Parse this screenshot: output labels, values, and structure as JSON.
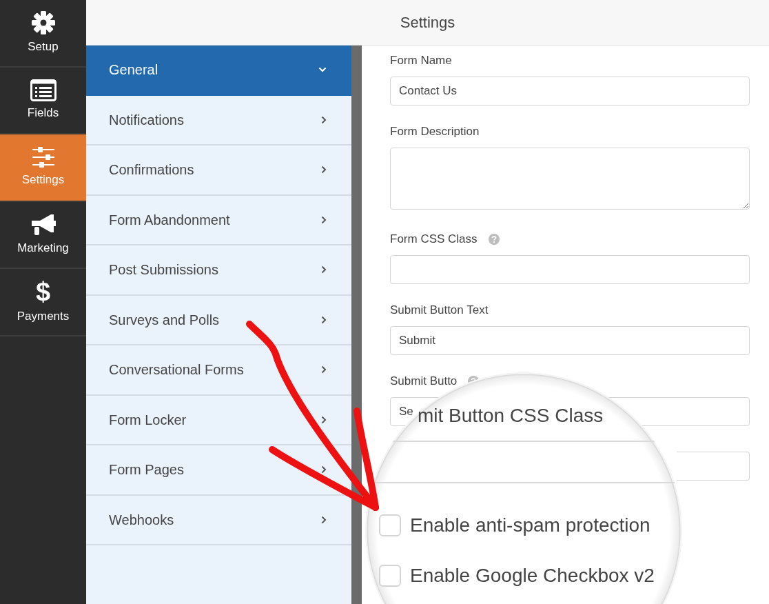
{
  "sidebar": {
    "items": [
      {
        "label": "Setup",
        "kind": "gear",
        "selected": false
      },
      {
        "label": "Fields",
        "kind": "list",
        "selected": false
      },
      {
        "label": "Settings",
        "kind": "sliders",
        "selected": true
      },
      {
        "label": "Marketing",
        "kind": "megaphone",
        "selected": false
      },
      {
        "label": "Payments",
        "kind": "glyph",
        "glyph": "$",
        "selected": false
      }
    ]
  },
  "header": {
    "title": "Settings"
  },
  "sections": [
    {
      "label": "General",
      "selected": true
    },
    {
      "label": "Notifications",
      "selected": false
    },
    {
      "label": "Confirmations",
      "selected": false
    },
    {
      "label": "Form Abandonment",
      "selected": false
    },
    {
      "label": "Post Submissions",
      "selected": false
    },
    {
      "label": "Surveys and Polls",
      "selected": false
    },
    {
      "label": "Conversational Forms",
      "selected": false
    },
    {
      "label": "Form Locker",
      "selected": false
    },
    {
      "label": "Form Pages",
      "selected": false
    },
    {
      "label": "Webhooks",
      "selected": false
    }
  ],
  "form": {
    "fields": [
      {
        "label": "Form Name",
        "kind": "input",
        "value": "Contact Us",
        "help": false
      },
      {
        "label": "Form Description",
        "kind": "textarea",
        "help": false
      },
      {
        "label": "Form CSS Class",
        "kind": "input",
        "help": true
      },
      {
        "label": "Submit Button Text",
        "kind": "input",
        "value": "Submit",
        "help": false
      },
      {
        "label": "Submit Butto",
        "kind": "input",
        "value": "Se",
        "help": true
      },
      {
        "kind": "input",
        "help": false
      }
    ]
  },
  "magnifier": {
    "label": "mit Button CSS Class",
    "checkboxes": [
      {
        "label": "Enable anti-spam protection",
        "checked": false
      },
      {
        "label": "Enable Google Checkbox v2",
        "checked": false
      }
    ]
  }
}
